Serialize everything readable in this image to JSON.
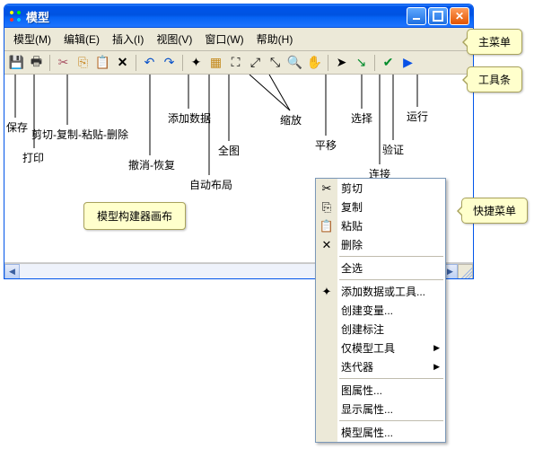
{
  "window": {
    "title": "模型"
  },
  "menubar": [
    {
      "label": "模型(M)"
    },
    {
      "label": "编辑(E)"
    },
    {
      "label": "插入(I)"
    },
    {
      "label": "视图(V)"
    },
    {
      "label": "窗口(W)"
    },
    {
      "label": "帮助(H)"
    }
  ],
  "toolbar_labels": {
    "save": "保存",
    "print": "打印",
    "cut_copy_paste_delete": "剪切-复制-粘贴-删除",
    "undo_redo": "撤消-恢复",
    "add_data": "添加数据",
    "auto_layout": "自动布局",
    "full_extent": "全图",
    "zoom": "缩放",
    "pan": "平移",
    "select": "选择",
    "connect": "连接",
    "validate": "验证",
    "run": "运行"
  },
  "canvas_note": "模型构建器画布",
  "callouts": {
    "main_menu": "主菜单",
    "toolbar": "工具条",
    "context_menu": "快捷菜单"
  },
  "context_menu": {
    "cut": "剪切",
    "copy": "复制",
    "paste": "粘贴",
    "delete": "删除",
    "select_all": "全选",
    "add_data_or_tools": "添加数据或工具...",
    "create_variable": "创建变量...",
    "create_label": "创建标注",
    "model_only_tools": "仅模型工具",
    "iterator": "迭代器",
    "diagram_props": "图属性...",
    "display_props": "显示属性...",
    "model_props": "模型属性..."
  }
}
